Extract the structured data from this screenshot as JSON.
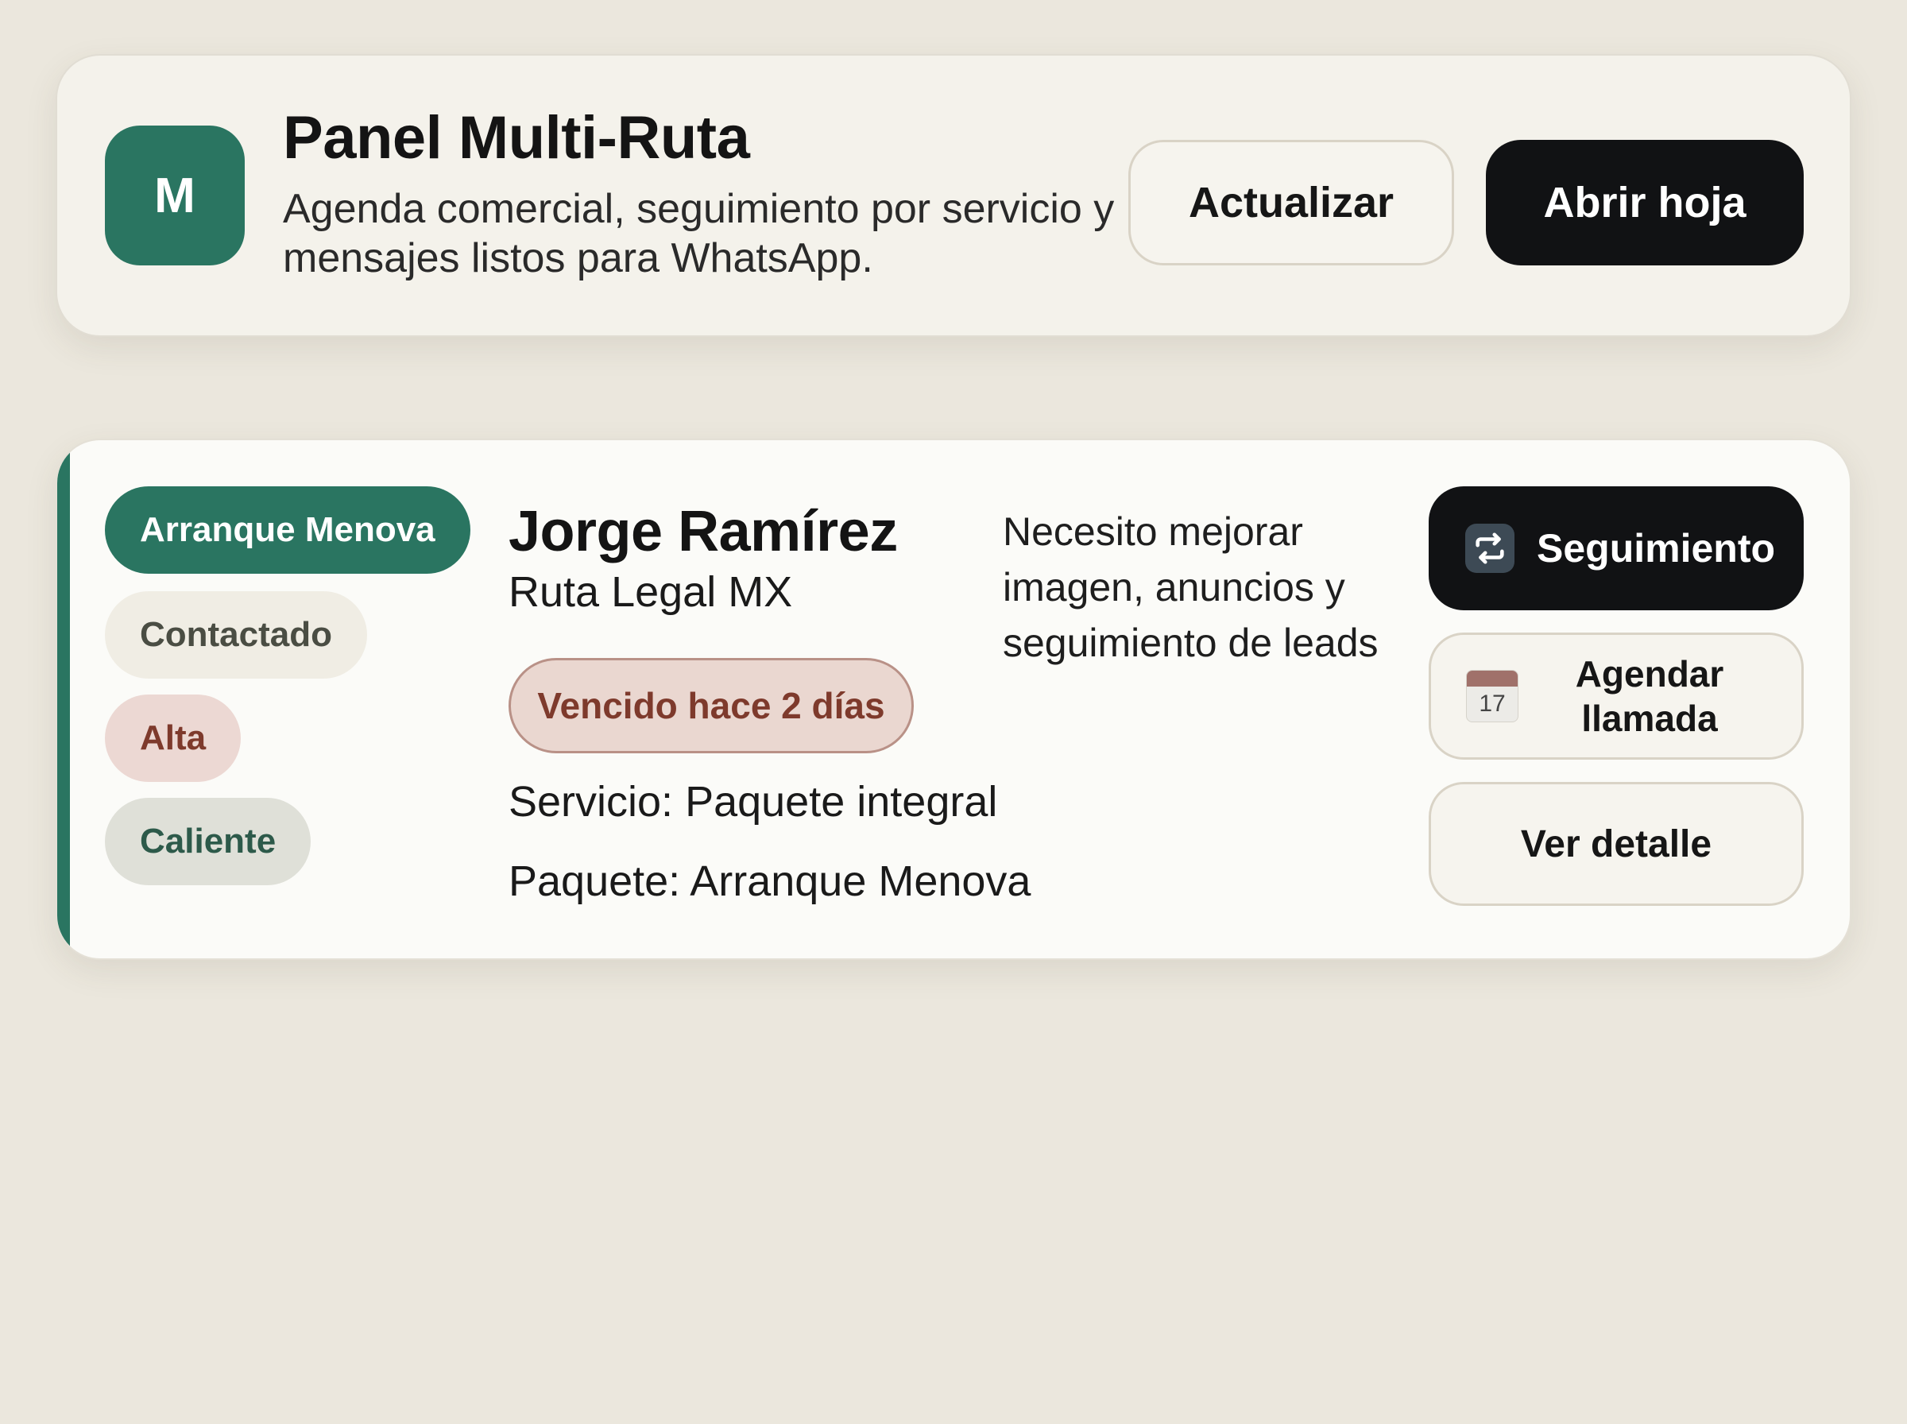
{
  "header": {
    "logo_letter": "M",
    "title": "Panel Multi-Ruta",
    "subtitle": "Agenda comercial, seguimiento por servicio y mensajes listos para WhatsApp.",
    "refresh_label": "Actualizar",
    "open_sheet_label": "Abrir hoja"
  },
  "lead": {
    "tags": {
      "package": "Arranque Menova",
      "status": "Contactado",
      "priority": "Alta",
      "temperature": "Caliente"
    },
    "name": "Jorge Ramírez",
    "company": "Ruta Legal MX",
    "overdue": "Vencido hace 2 días",
    "service_line": "Servicio: Paquete integral",
    "package_line": "Paquete: Arranque Menova",
    "need": "Necesito mejorar imagen, anuncios y seguimiento de leads",
    "actions": {
      "follow_up": "Seguimiento",
      "schedule": "Agendar llamada",
      "calendar_day": "17",
      "detail": "Ver detalle"
    }
  },
  "colors": {
    "background": "#ebe7dd",
    "accent_green": "#2a7561",
    "dark_button": "#111214",
    "overdue_text": "#7e3a2c",
    "overdue_bg": "#ead7d0"
  },
  "icons": {
    "follow_up": "repeat-arrows-icon",
    "schedule": "calendar-icon"
  }
}
